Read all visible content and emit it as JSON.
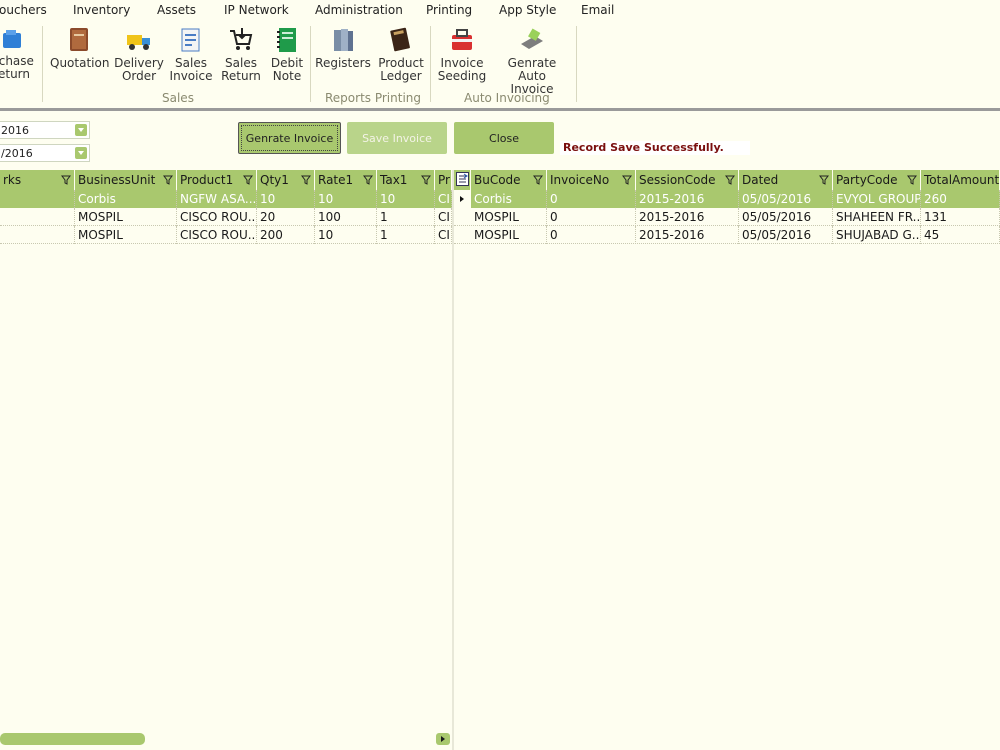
{
  "menu": [
    "ouchers",
    "Inventory",
    "Assets",
    "IP Network",
    "Administration",
    "Printing",
    "App Style",
    "Email"
  ],
  "ribbon": {
    "buttons": [
      {
        "label": "rchase\neturn",
        "icon": "purchase-return-icon"
      },
      {
        "label": "Quotation",
        "icon": "book-icon"
      },
      {
        "label": "Delivery\nOrder",
        "icon": "truck-icon"
      },
      {
        "label": "Sales\nInvoice",
        "icon": "invoice-icon"
      },
      {
        "label": "Sales\nReturn",
        "icon": "cart-return-icon"
      },
      {
        "label": "Debit\nNote",
        "icon": "notebook-icon"
      },
      {
        "label": "Registers",
        "icon": "registers-icon"
      },
      {
        "label": "Product\nLedger",
        "icon": "ledger-icon"
      },
      {
        "label": "Invoice\nSeeding",
        "icon": "bag-icon"
      },
      {
        "label": "Genrate Auto\nInvoice",
        "icon": "card-machine-icon"
      }
    ],
    "groups": [
      "Sales",
      "Reports Printing",
      "Auto Invoicing"
    ]
  },
  "filters": {
    "date_from": "2016",
    "date_to": "/2016"
  },
  "actions": {
    "generate": "Genrate Invoice",
    "save": "Save Invoice",
    "close": "Close"
  },
  "status": "Record Save Successfully.",
  "left_grid": {
    "columns": [
      "rks",
      "BusinessUnit",
      "Product1",
      "Qty1",
      "Rate1",
      "Tax1",
      "Pr"
    ],
    "rows": [
      [
        "",
        "Corbis",
        "NGFW  ASA...",
        "10",
        "10",
        "10",
        "CI"
      ],
      [
        "",
        "MOSPIL",
        "CISCO  ROU...",
        "20",
        "100",
        "1",
        "CI"
      ],
      [
        "",
        "MOSPIL",
        "CISCO  ROU...",
        "200",
        "10",
        "1",
        "CI"
      ]
    ]
  },
  "right_grid": {
    "columns": [
      "BuCode",
      "InvoiceNo",
      "SessionCode",
      "Dated",
      "PartyCode",
      "TotalAmount"
    ],
    "rows": [
      [
        "Corbis",
        "0",
        "2015-2016",
        "05/05/2016",
        "EVYOL GROUP",
        "260"
      ],
      [
        "MOSPIL",
        "0",
        "2015-2016",
        "05/05/2016",
        "SHAHEEN  FR...",
        "131"
      ],
      [
        "MOSPIL",
        "0",
        "2015-2016",
        "05/05/2016",
        "SHUJABAD  G...",
        "45"
      ]
    ]
  },
  "colors": {
    "accent": "#a9c86e",
    "background": "#fefef0",
    "status_text": "#7a0f0f"
  }
}
